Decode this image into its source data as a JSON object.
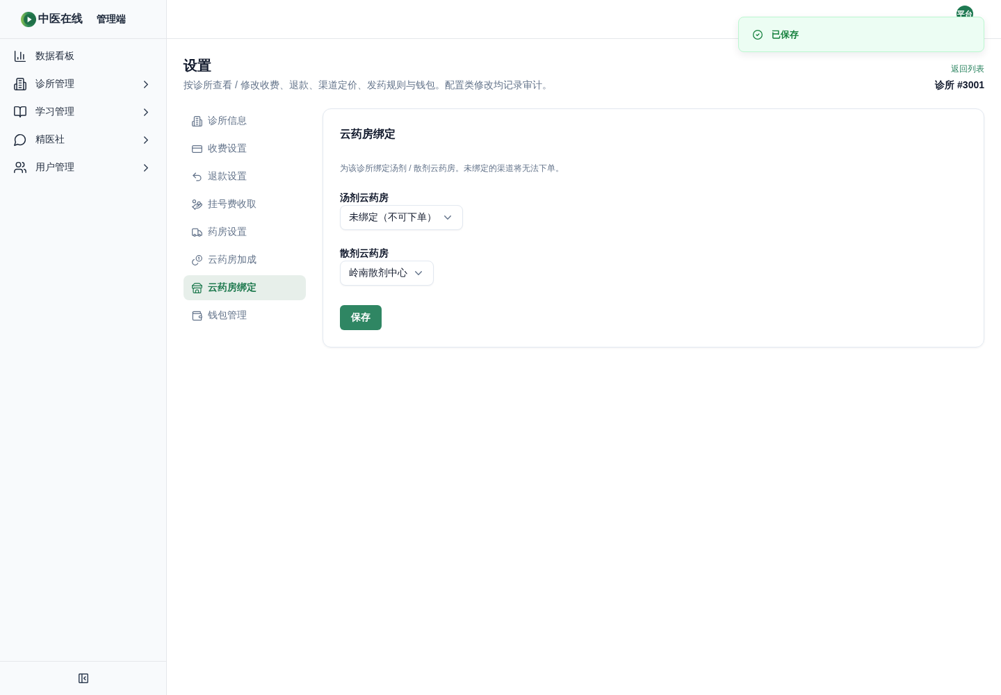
{
  "sidebar": {
    "brand": {
      "name": "中医在线",
      "subtitle": "管理端"
    },
    "items": [
      {
        "label": "数据看板",
        "expandable": false
      },
      {
        "label": "诊所管理",
        "expandable": true
      },
      {
        "label": "学习管理",
        "expandable": true
      },
      {
        "label": "精医社",
        "expandable": true
      },
      {
        "label": "用户管理",
        "expandable": true
      }
    ]
  },
  "header": {
    "avatar": "平台"
  },
  "toast": {
    "kind": "success",
    "message": "已保存"
  },
  "page": {
    "title": "设置",
    "subtitle": "按诊所查看 / 修改收费、退款、渠道定价、发药规则与钱包。配置类修改均记录审计。",
    "back_link": "返回列表",
    "clinic": "诊所 #3001"
  },
  "settings_nav": [
    {
      "label": "诊所信息",
      "selected": false
    },
    {
      "label": "收费设置",
      "selected": false
    },
    {
      "label": "退款设置",
      "selected": false
    },
    {
      "label": "挂号费收取",
      "selected": false
    },
    {
      "label": "药房设置",
      "selected": false
    },
    {
      "label": "云药房加成",
      "selected": false
    },
    {
      "label": "云药房绑定",
      "selected": true
    },
    {
      "label": "钱包管理",
      "selected": false
    }
  ],
  "panel": {
    "title": "云药房绑定",
    "description": "为该诊所绑定汤剂 / 散剂云药房。未绑定的渠道将无法下单。",
    "fields": [
      {
        "label": "汤剂云药房",
        "value": "未绑定（不可下单）"
      },
      {
        "label": "散剂云药房",
        "value": "岭南散剂中心"
      }
    ],
    "save_button": "保存"
  }
}
